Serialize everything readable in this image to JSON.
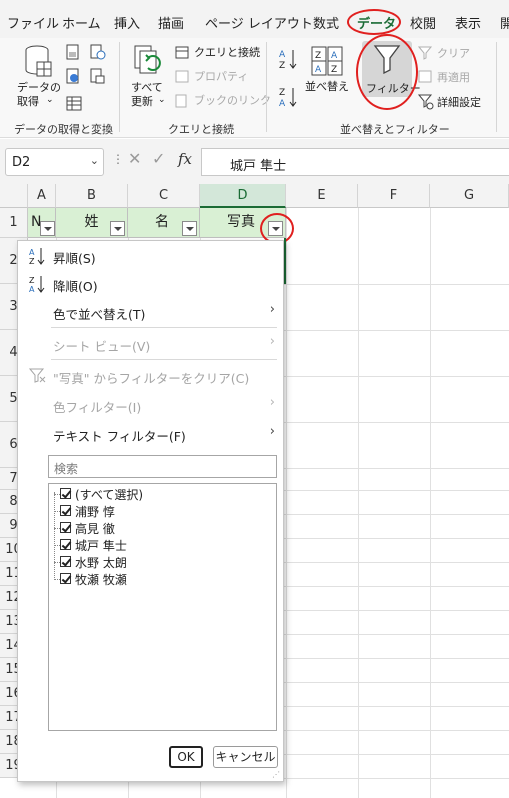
{
  "tabs": [
    "ファイル",
    "ホーム",
    "挿入",
    "描画",
    "ページ レイアウト",
    "数式",
    "データ",
    "校閲",
    "表示",
    "開"
  ],
  "ribbon": {
    "get_data_label_1": "データの",
    "get_data_label_2": "取得",
    "group_get_transform": "データの取得と変換",
    "refresh_label_1": "すべて",
    "refresh_label_2": "更新",
    "queries_connections": "クエリと接続",
    "properties": "プロパティ",
    "edit_links": "ブックのリンク",
    "group_queries": "クエリと接続",
    "sort": "並べ替え",
    "filter": "フィルター",
    "clear": "クリア",
    "reapply": "再適用",
    "advanced": "詳細設定",
    "group_sort_filter": "並べ替えとフィルター"
  },
  "formula_bar": {
    "name_box": "D2",
    "formula_value": "城戸 隼士"
  },
  "grid": {
    "columns": [
      "A",
      "B",
      "C",
      "D",
      "E",
      "F",
      "G"
    ],
    "rows": [
      "1",
      "2",
      "3",
      "4",
      "5",
      "6",
      "7",
      "8",
      "9",
      "10",
      "11",
      "12",
      "13",
      "14",
      "15",
      "16",
      "17",
      "18",
      "19"
    ],
    "header_cells": [
      "N",
      "姓",
      "名",
      "写真"
    ]
  },
  "dropdown": {
    "sort_asc": "昇順(S)",
    "sort_desc": "降順(O)",
    "sort_by_color": "色で並べ替え(T)",
    "sheet_view": "シート ビュー(V)",
    "clear_filter": "\"写真\" からフィルターをクリア(C)",
    "color_filter": "色フィルター(I)",
    "text_filter": "テキスト フィルター(F)",
    "search_placeholder": "検索",
    "items": [
      "(すべて選択)",
      "浦野 惇",
      "高見 徹",
      "城戸 隼士",
      "水野 太朗",
      "牧瀬 牧瀬"
    ],
    "ok": "OK",
    "cancel": "キャンセル"
  },
  "colors": {
    "accent_green": "#1b6b35",
    "highlight_red": "#e0201f",
    "header_fill": "#d9f0d4"
  }
}
